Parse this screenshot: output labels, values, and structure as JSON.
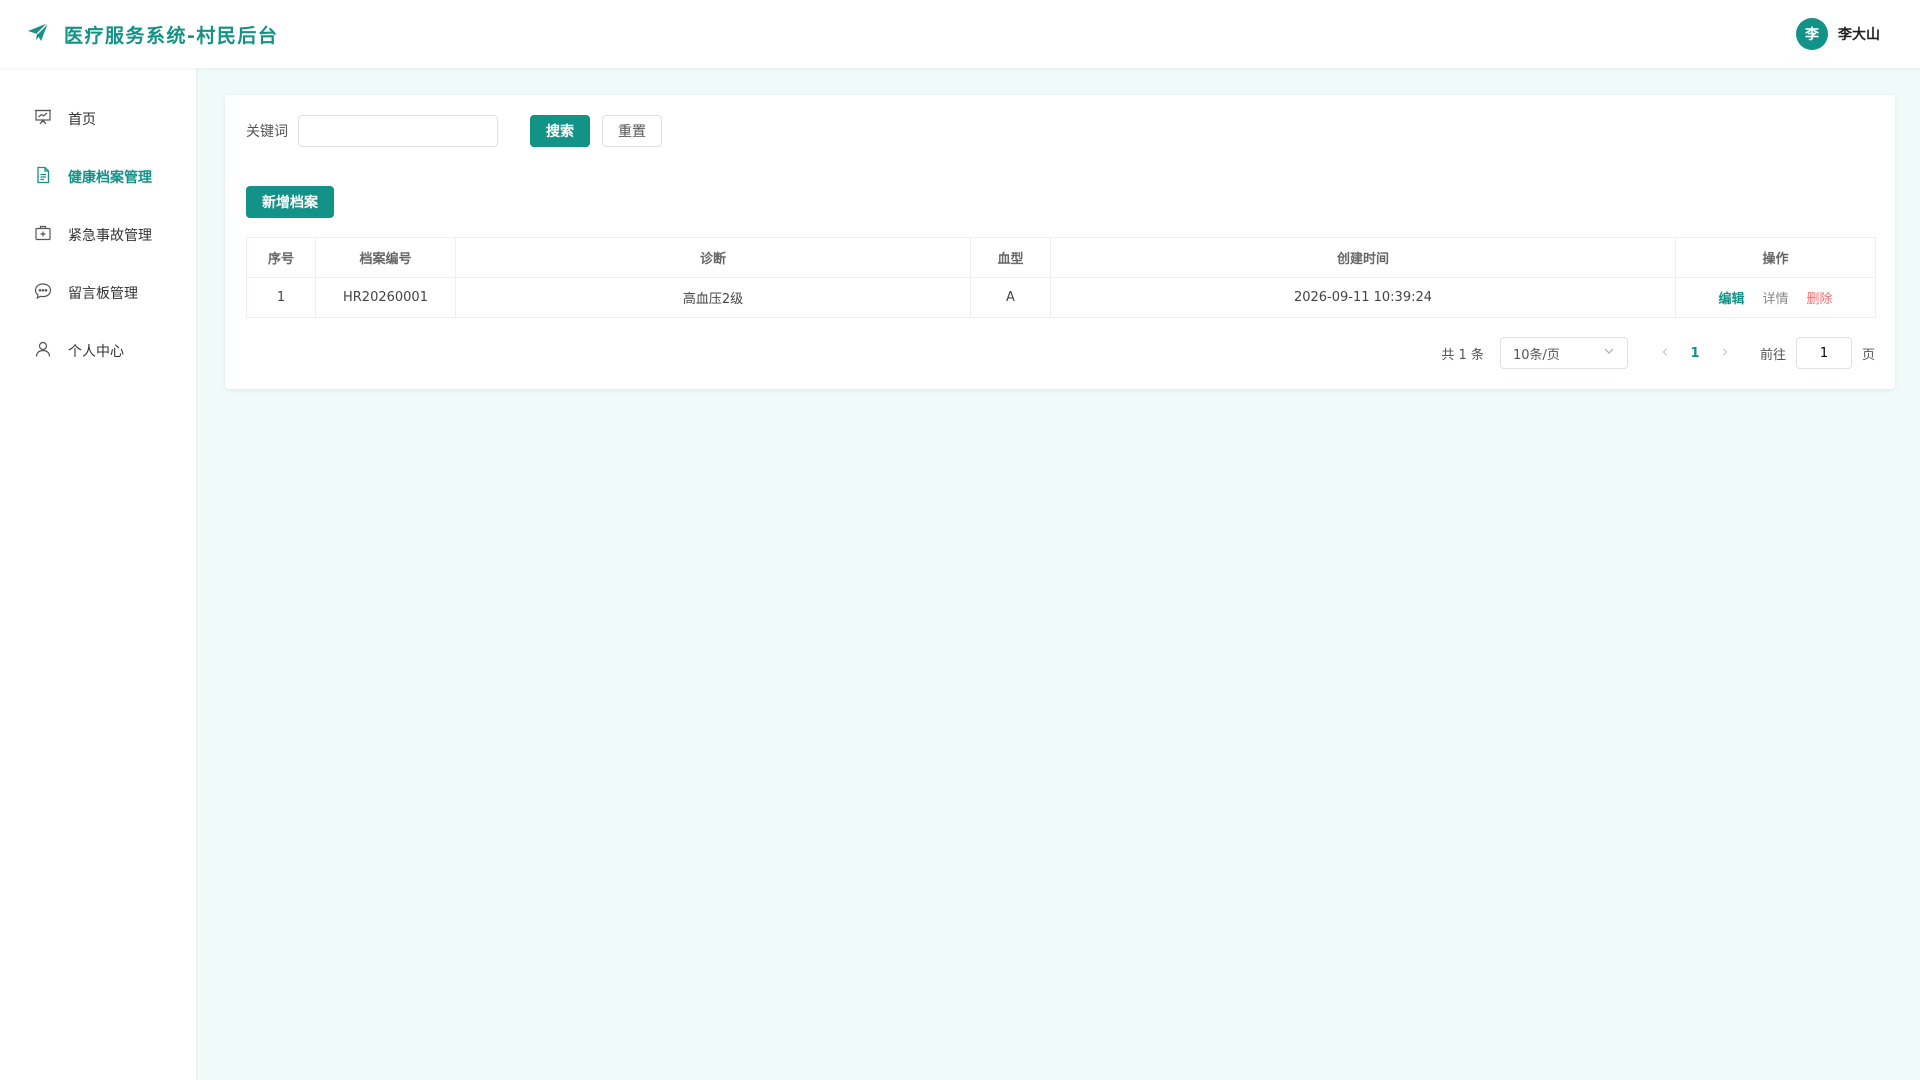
{
  "app": {
    "title": "医疗服务系统-村民后台",
    "brand_color": "#139387",
    "logo_icon": "paper-plane-icon"
  },
  "user": {
    "avatar_text": "李",
    "name": "李大山"
  },
  "sidebar": {
    "items": [
      {
        "label": "首页",
        "icon": "presentation-chart-icon",
        "active": false
      },
      {
        "label": "健康档案管理",
        "icon": "document-icon",
        "active": true
      },
      {
        "label": "紧急事故管理",
        "icon": "first-aid-kit-icon",
        "active": false
      },
      {
        "label": "留言板管理",
        "icon": "chat-bubble-icon",
        "active": false
      },
      {
        "label": "个人中心",
        "icon": "user-icon",
        "active": false
      }
    ]
  },
  "search": {
    "label": "关键词",
    "value": "",
    "placeholder": "",
    "search_button": "搜索",
    "reset_button": "重置"
  },
  "toolbar": {
    "add_button": "新增档案"
  },
  "table": {
    "headers": [
      "序号",
      "档案编号",
      "诊断",
      "血型",
      "创建时间",
      "操作"
    ],
    "rows": [
      {
        "index": "1",
        "record_no": "HR20260001",
        "diagnosis": "高血压2级",
        "blood_type": "A",
        "created_at": "2026-09-11 10:39:24"
      }
    ],
    "actions": {
      "edit": "编辑",
      "detail": "详情",
      "delete": "删除"
    }
  },
  "pagination": {
    "total_text": "共 1 条",
    "page_size": "10条/页",
    "current_page": "1",
    "goto_label": "前往",
    "goto_value": "1",
    "goto_suffix": "页"
  }
}
